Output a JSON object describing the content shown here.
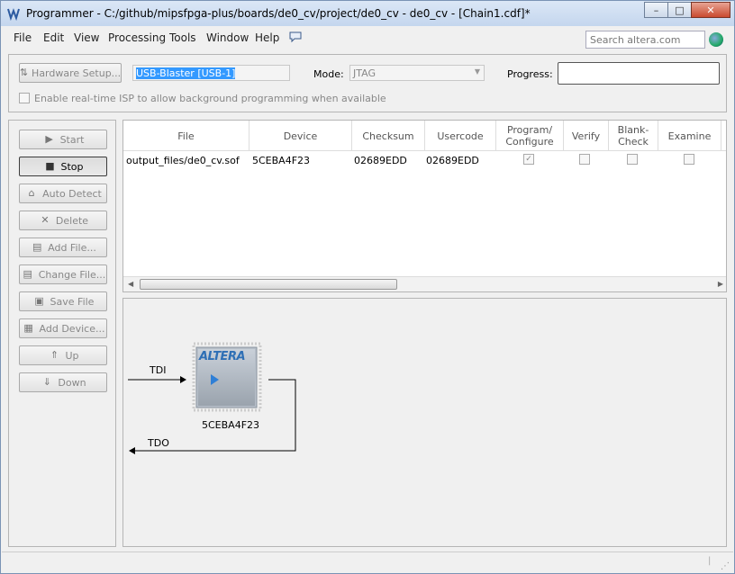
{
  "window": {
    "title": "Programmer - C:/github/mipsfpga-plus/boards/de0_cv/project/de0_cv - de0_cv - [Chain1.cdf]*",
    "min": "–",
    "max": "□",
    "close": "✕"
  },
  "menu": {
    "file": "File",
    "edit": "Edit",
    "view": "View",
    "processing": "Processing",
    "tools": "Tools",
    "window": "Window",
    "help": "Help",
    "search_placeholder": "Search altera.com"
  },
  "hardware": {
    "setup_label": "Hardware Setup...",
    "device": "USB-Blaster [USB-1]",
    "mode_label": "Mode:",
    "mode_value": "JTAG",
    "progress_label": "Progress:",
    "isp_label": "Enable real-time ISP to allow background programming when available"
  },
  "actions": {
    "start": "Start",
    "stop": "Stop",
    "auto_detect": "Auto Detect",
    "delete": "Delete",
    "add_file": "Add File...",
    "change_file": "Change File...",
    "save_file": "Save File",
    "add_device": "Add Device...",
    "up": "Up",
    "down": "Down"
  },
  "table": {
    "headers": {
      "file": "File",
      "device": "Device",
      "checksum": "Checksum",
      "usercode": "Usercode",
      "program_l1": "Program/",
      "program_l2": "Configure",
      "verify": "Verify",
      "blank_l1": "Blank-",
      "blank_l2": "Check",
      "examine": "Examine"
    },
    "rows": [
      {
        "file": "output_files/de0_cv.sof",
        "device": "5CEBA4F23",
        "checksum": "02689EDD",
        "usercode": "02689EDD",
        "program": true,
        "verify": false,
        "blank_check": false,
        "examine": false
      }
    ]
  },
  "chain": {
    "tdi": "TDI",
    "tdo": "TDO",
    "chip_logo": "ALTERA",
    "chip_device": "5CEBA4F23"
  }
}
